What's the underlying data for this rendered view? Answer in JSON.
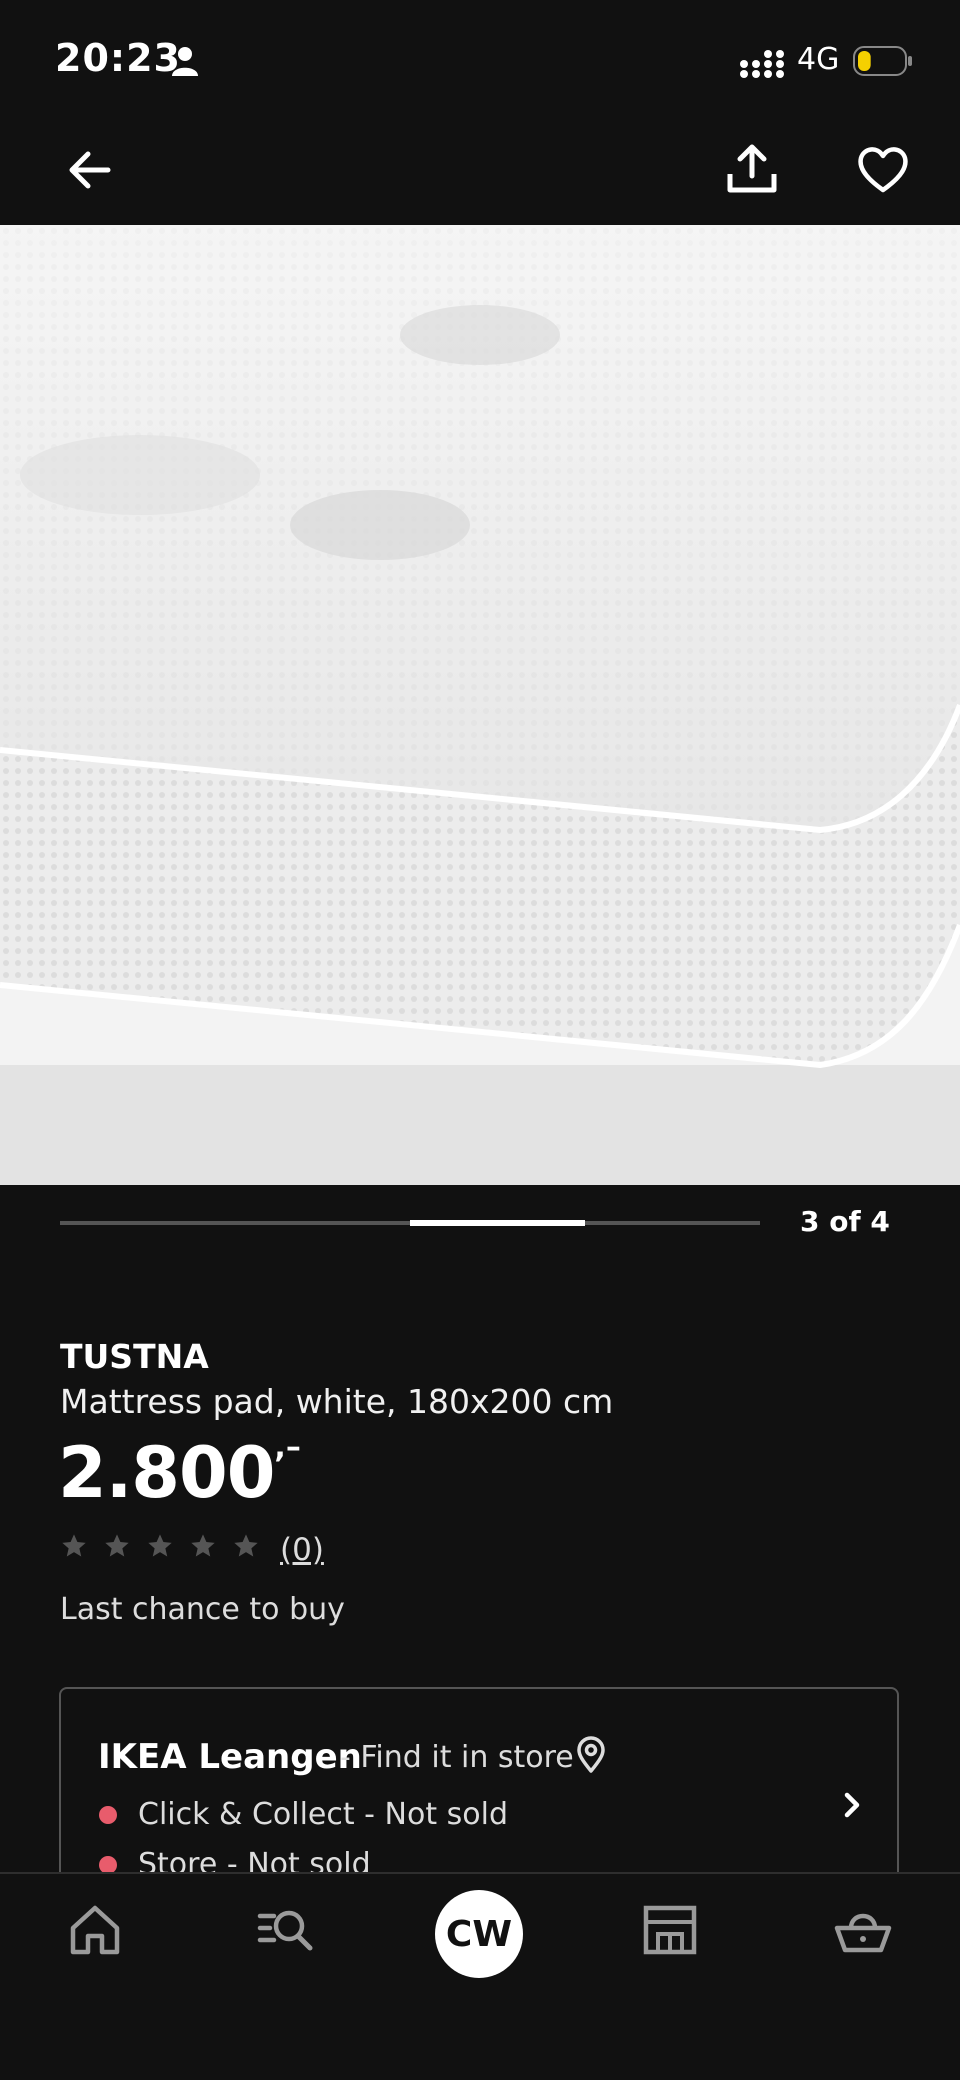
{
  "status_bar": {
    "time": "20:23",
    "network": "4G",
    "battery_level": 0.18,
    "battery_color": "#f5d000"
  },
  "top_nav": {
    "back_icon": "arrow-left-icon",
    "share_icon": "share-upload-icon",
    "favorite_icon": "heart-icon"
  },
  "carousel": {
    "current": 3,
    "total": 4,
    "label": "3 of 4"
  },
  "product": {
    "brand": "TUSTNA",
    "description": "Mattress pad, white, 180x200 cm",
    "price": "2.800",
    "price_suffix": ",–",
    "rating_stars": 5,
    "rating_value": 0,
    "review_count": "(0)",
    "note": "Last chance to buy"
  },
  "store": {
    "name": "IKEA Leangen",
    "find_label": "- Find it in store",
    "status_color": "#e85c6c",
    "click_collect": "Click & Collect - Not sold",
    "store_status": "Store - Not sold"
  },
  "bottom_nav": {
    "avatar_initials": "CW",
    "items": [
      "home-icon",
      "search-list-icon",
      "avatar",
      "store-icon",
      "basket-icon"
    ]
  }
}
